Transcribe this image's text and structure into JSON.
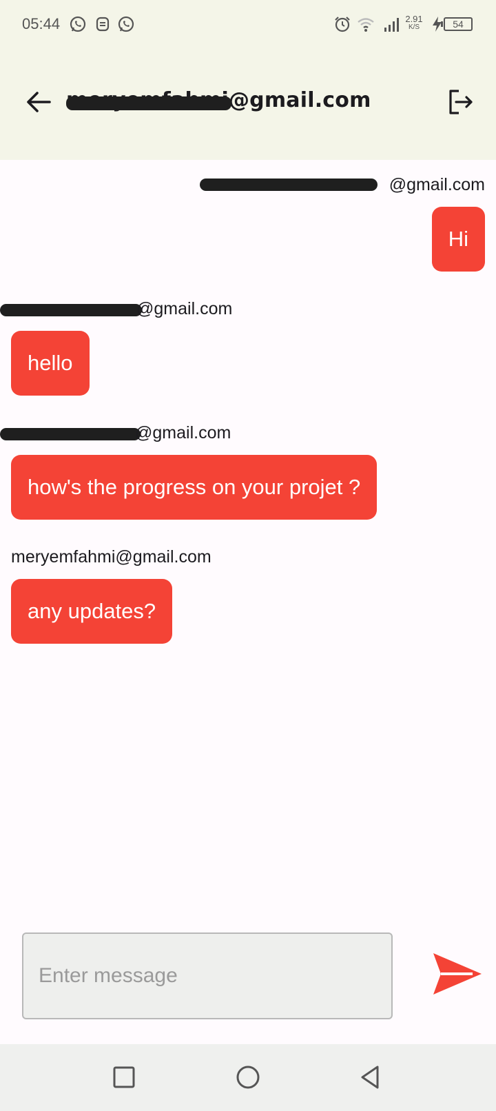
{
  "status_bar": {
    "time": "05:44",
    "network_speed_value": "2.91",
    "network_speed_unit": "K/S",
    "battery": "54",
    "icons": [
      "whatsapp-icon",
      "notification-app-icon",
      "whatsapp-icon",
      "alarm-icon",
      "wifi-icon",
      "signal-icon",
      "charging-icon",
      "battery-icon"
    ]
  },
  "app_bar": {
    "title": "meryemfahmi@gmail.com",
    "back_icon": "arrow-back-icon",
    "logout_icon": "logout-icon"
  },
  "messages": [
    {
      "sender": "@gmail.com",
      "text": "Hi",
      "sent_by_me": true
    },
    {
      "sender": "@gmail.com",
      "text": "hello",
      "sent_by_me": false
    },
    {
      "sender": "@gmail.com",
      "text": "how's the progress on your projet ?",
      "sent_by_me": false
    },
    {
      "sender": "meryemfahmi@gmail.com",
      "text": "any updates?",
      "sent_by_me": false
    }
  ],
  "composer": {
    "placeholder": "Enter message",
    "value": "",
    "send_icon": "send-icon"
  },
  "nav_bar": {
    "icons": [
      "recents-square-icon",
      "home-circle-icon",
      "back-triangle-icon"
    ]
  },
  "colors": {
    "bubble": "#f44336",
    "app_bar_bg": "#f4f5e8",
    "screen_bg": "#fffbfe",
    "send_icon": "#f44336"
  }
}
